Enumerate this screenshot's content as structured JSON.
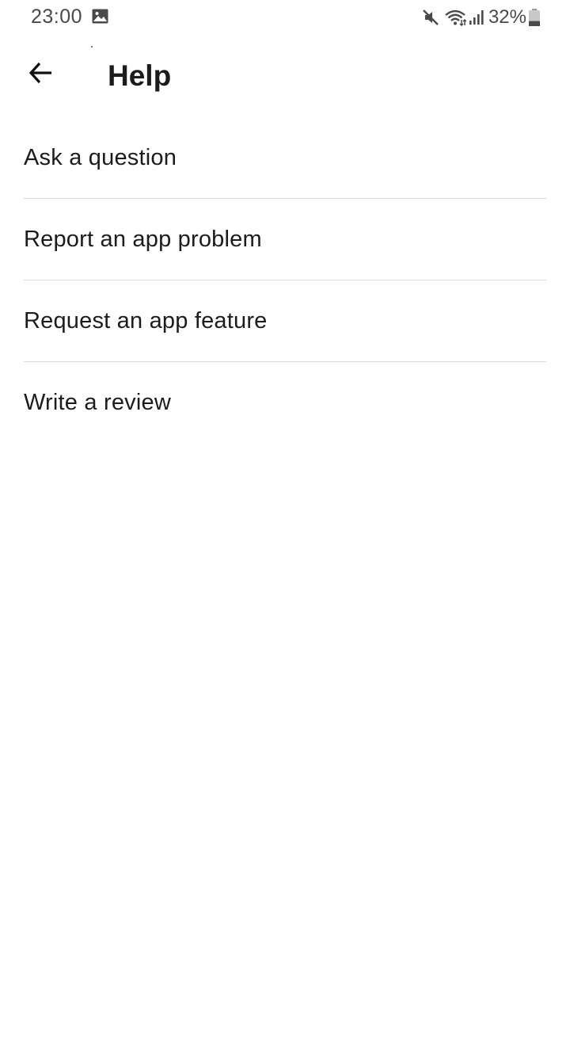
{
  "status_bar": {
    "time": "23:00",
    "battery_percent": "32%",
    "icons": [
      "gallery-icon",
      "mute-icon",
      "wifi-icon",
      "signal-icon",
      "battery-icon"
    ],
    "battery_level": 0.32
  },
  "header": {
    "title": "Help",
    "back_icon": "back-arrow-icon"
  },
  "help_items": [
    {
      "label": "Ask a question"
    },
    {
      "label": "Report an app problem"
    },
    {
      "label": "Request an app feature"
    },
    {
      "label": "Write a review"
    }
  ],
  "colors": {
    "text": "#1c1c1c",
    "status_text": "#4a4a4a",
    "divider": "#dcdcdc",
    "background": "#ffffff"
  }
}
